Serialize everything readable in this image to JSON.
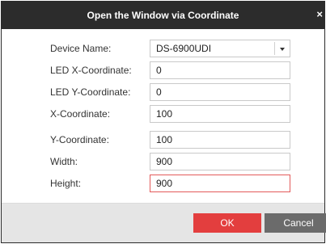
{
  "dialog": {
    "title": "Open the Window via Coordinate",
    "close_glyph": "×"
  },
  "form": {
    "device_name": {
      "label": "Device Name:",
      "value": "DS-6900UDI"
    },
    "led_x": {
      "label": "LED X-Coordinate:",
      "value": "0"
    },
    "led_y": {
      "label": "LED Y-Coordinate:",
      "value": "0"
    },
    "x": {
      "label": "X-Coordinate:",
      "value": "100"
    },
    "y": {
      "label": "Y-Coordinate:",
      "value": "100"
    },
    "width": {
      "label": "Width:",
      "value": "900"
    },
    "height": {
      "label": "Height:",
      "value": "900"
    }
  },
  "buttons": {
    "ok_label": "OK",
    "cancel_label": "Cancel"
  },
  "colors": {
    "titlebar": "#2c2c2c",
    "ok": "#e33e3e",
    "cancel": "#6b6b6b",
    "error_border": "#e35a5a",
    "footer": "#e5e5e5"
  }
}
